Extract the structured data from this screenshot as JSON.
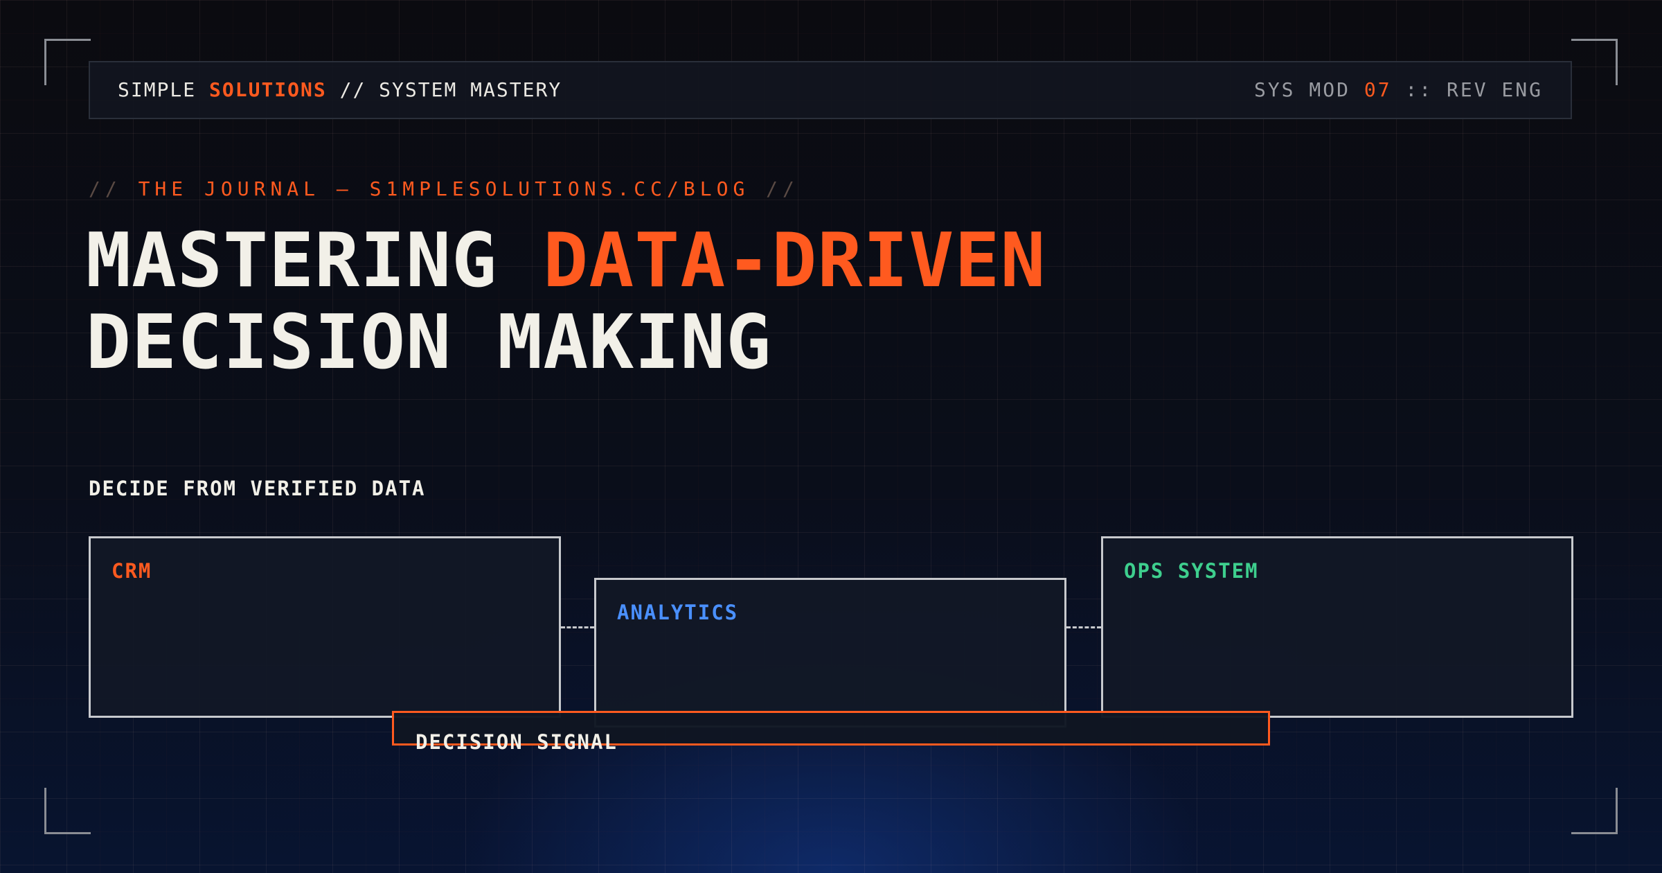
{
  "header": {
    "brand_simple": "SIMPLE",
    "brand_solutions": "SOLUTIONS",
    "brand_rest": "// SYSTEM MASTERY",
    "sys_prefix": "SYS MOD",
    "sys_number": "07",
    "sys_suffix": ":: REV ENG"
  },
  "kicker": {
    "open": "//",
    "text": "THE JOURNAL — S1MPLESOLUTIONS.CC/BLOG",
    "close": "//"
  },
  "headline": {
    "line1_plain": "MASTERING",
    "line1_accent": "DATA-DRIVEN",
    "line2": "DECISION MAKING"
  },
  "diagram": {
    "caption": "DECIDE FROM VERIFIED DATA",
    "sources": [
      {
        "label": "CRM",
        "color": "#ff5a1f"
      },
      {
        "label": "ANALYTICS",
        "color": "#4a90ff"
      },
      {
        "label": "OPS SYSTEM",
        "color": "#3ecf8e"
      }
    ],
    "output_label": "DECISION SIGNAL",
    "output_color": "#ff5a1f"
  },
  "colors": {
    "accent": "#ff5a1f",
    "text": "#f2f0e8",
    "muted": "#9a9ca2",
    "panel_border": "#c7c9cd"
  }
}
